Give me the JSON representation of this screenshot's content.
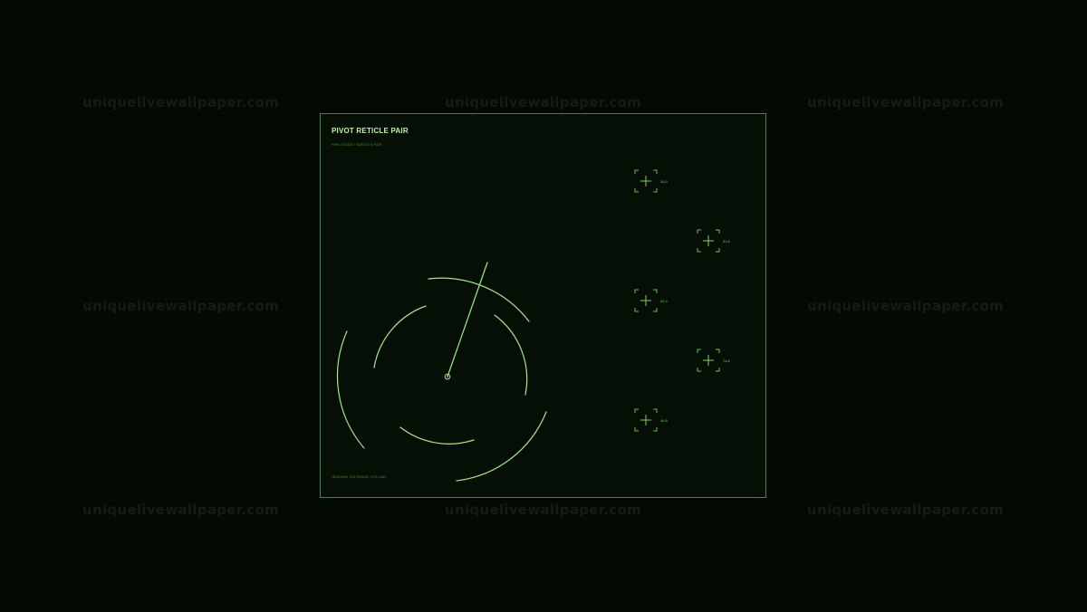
{
  "watermark": {
    "text": "uniquelivewallpaper.com"
  },
  "panel": {
    "title": "PIVOT RETICLE PAIR",
    "subtitle": "FIRE STAGE / TARGETS PAIR",
    "footer": "HEADING 120 RANGE 17% CAB"
  },
  "reticles": [
    {
      "label": "10.0"
    },
    {
      "label": "31.6"
    },
    {
      "label": "41.4"
    },
    {
      "label": "74.6"
    },
    {
      "label": "44.8"
    }
  ],
  "colors": {
    "accent": "#a6e88a",
    "border": "#3f8a2a",
    "reticle": "#5fc447",
    "background": "#030903",
    "panel": "#050f05",
    "watermark": "#141d14"
  }
}
